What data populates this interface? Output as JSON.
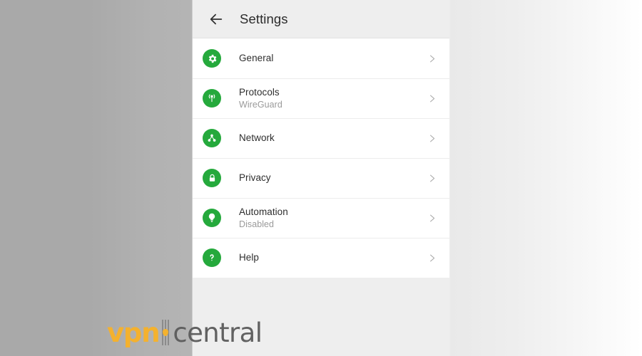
{
  "window": {
    "background_left_color": "#a9a9a9",
    "background_right_color": "#eeeeee",
    "screen_background_color": "#eeeeee"
  },
  "app_bar": {
    "back_icon": "arrow-left-icon",
    "title": "Settings"
  },
  "theme": {
    "icon_green": "#25a93c",
    "title_color": "#2e2e2e",
    "subtitle_color": "#9a9a9a",
    "divider_color": "#ececec",
    "card_color": "#ffffff"
  },
  "settings": {
    "rows": [
      {
        "id": "general",
        "icon": "gear-icon",
        "title": "General",
        "subtitle": "",
        "chevron": "chevron-right-icon"
      },
      {
        "id": "protocols",
        "icon": "protocol-signal-icon",
        "title": "Protocols",
        "subtitle": "WireGuard",
        "chevron": "chevron-right-icon"
      },
      {
        "id": "network",
        "icon": "network-nodes-icon",
        "title": "Network",
        "subtitle": "",
        "chevron": "chevron-right-icon"
      },
      {
        "id": "privacy",
        "icon": "lock-icon",
        "title": "Privacy",
        "subtitle": "",
        "chevron": "chevron-right-icon"
      },
      {
        "id": "automation",
        "icon": "lightbulb-icon",
        "title": "Automation",
        "subtitle": "Disabled",
        "chevron": "chevron-right-icon"
      },
      {
        "id": "help",
        "icon": "question-mark-icon",
        "title": "Help",
        "subtitle": "",
        "chevron": "chevron-right-icon"
      }
    ]
  },
  "watermark": {
    "brand_primary": "vpn",
    "brand_secondary": "central",
    "primary_color": "#f7b22a",
    "secondary_color": "#5d5d5d"
  }
}
